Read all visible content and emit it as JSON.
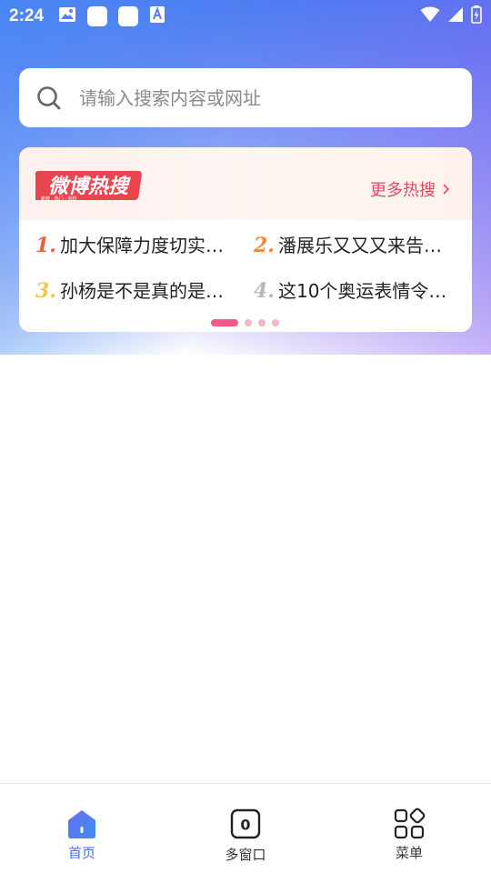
{
  "status_bar": {
    "time": "2:24"
  },
  "search": {
    "placeholder": "请输入搜索内容或网址"
  },
  "hot_search": {
    "logo_text": "微博热搜",
    "more_label": "更多热搜",
    "items": [
      {
        "rank": "1.",
        "text": "加大保障力度切实…",
        "color": "#e8623e"
      },
      {
        "rank": "2.",
        "text": "潘展乐又又又来告…",
        "color": "#ef8a3a"
      },
      {
        "rank": "3.",
        "text": "孙杨是不是真的是…",
        "color": "#f3c54a"
      },
      {
        "rank": "4.",
        "text": "这10个奥运表情令…",
        "color": "#b8b8b8"
      }
    ]
  },
  "bottom_nav": {
    "items": [
      {
        "label": "首页",
        "icon": "home-icon",
        "active": true
      },
      {
        "label": "多窗口",
        "icon": "window-count-icon",
        "count": "0"
      },
      {
        "label": "菜单",
        "icon": "menu-grid-icon"
      }
    ]
  },
  "colors": {
    "accent": "#4a6ee8",
    "hot_accent": "#e94561"
  }
}
